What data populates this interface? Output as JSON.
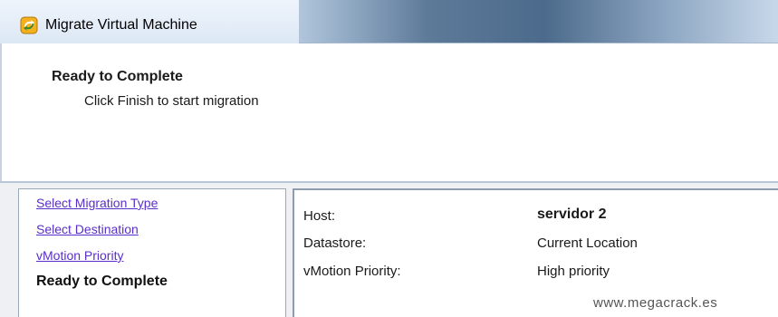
{
  "window": {
    "title": "Migrate Virtual Machine",
    "icon": "vm-migrate-icon"
  },
  "header": {
    "title": "Ready to Complete",
    "subtitle": "Click Finish to start migration"
  },
  "nav": {
    "items": [
      {
        "label": "Select Migration Type",
        "state": "link"
      },
      {
        "label": "Select Destination",
        "state": "link"
      },
      {
        "label": "vMotion Priority",
        "state": "link"
      },
      {
        "label": "Ready to Complete",
        "state": "current"
      }
    ]
  },
  "summary": {
    "rows": [
      {
        "label": "Host:",
        "value": "servidor 2"
      },
      {
        "label": "Datastore:",
        "value": "Current Location"
      },
      {
        "label": "vMotion Priority:",
        "value": "High priority"
      }
    ]
  },
  "watermark": "www.megacrack.es",
  "colors": {
    "link": "#5a2ec8",
    "titlebar_dark": "#4c6a8b",
    "panel_border": "#8e9cae"
  }
}
